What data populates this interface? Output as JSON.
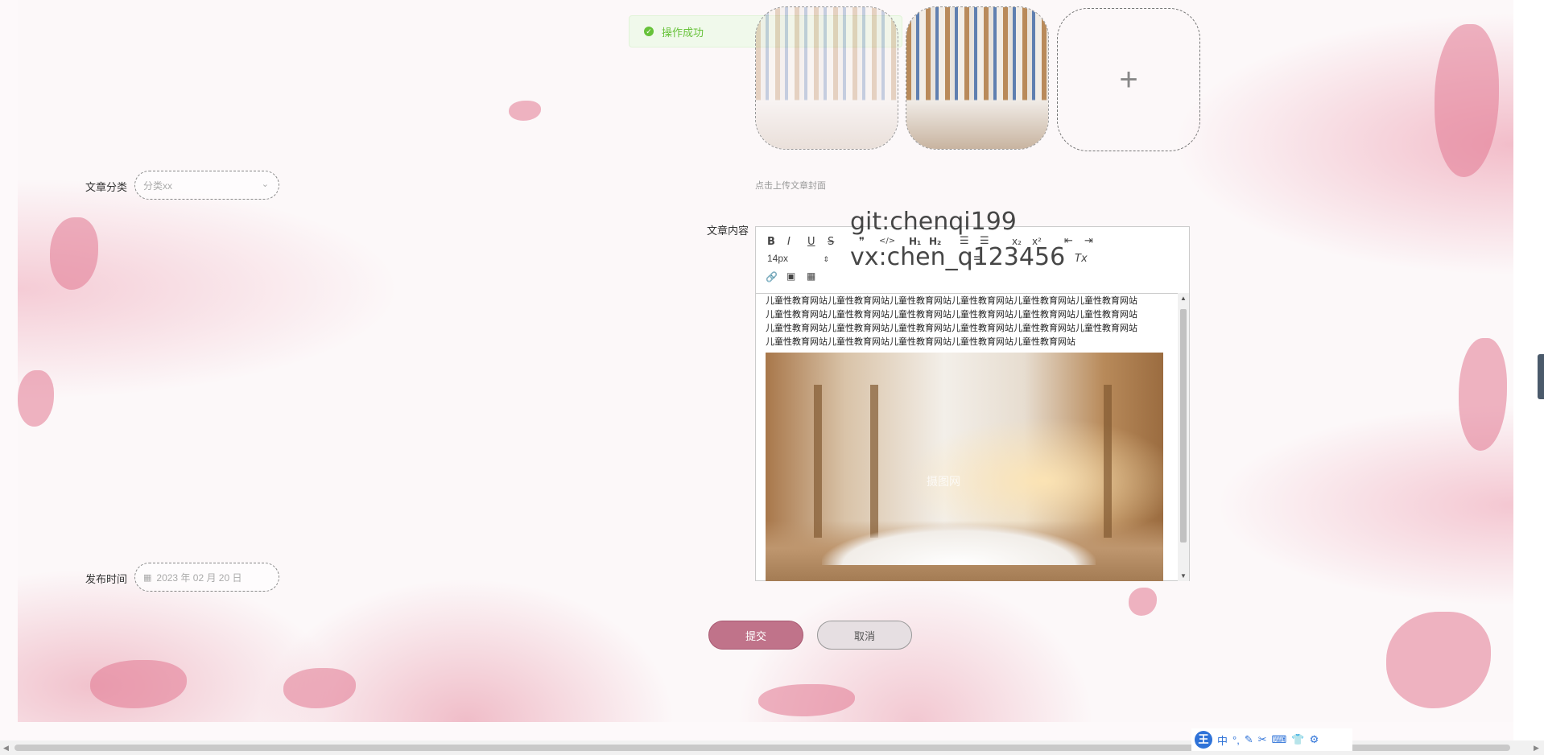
{
  "toast": {
    "icon": "check-circle-icon",
    "message": "操作成功"
  },
  "cover": {
    "tip": "点击上传文章封面",
    "add_icon": "plus-icon",
    "add_symbol": "+"
  },
  "form": {
    "category": {
      "label": "文章分类",
      "placeholder": "分类xx",
      "icon": "chevron-down-icon"
    },
    "content": {
      "label": "文章内容"
    },
    "publish_time": {
      "label": "发布时间",
      "value": "2023 年 02 月 20 日",
      "icon": "calendar-icon"
    }
  },
  "editor": {
    "toolbar": {
      "row1": [
        "B",
        "I",
        "U",
        "S",
        "❞",
        "</>",
        "H₁",
        "H₂",
        "ol",
        "ul",
        "x₂",
        "x²",
        "outdent",
        "indent"
      ],
      "font_size": "14px",
      "row3": [
        "link",
        "image",
        "video"
      ],
      "clear": "Tx"
    },
    "text_lines": [
      "儿童性教育网站儿童性教育网站儿童性教育网站儿童性教育网站儿童性教育网站儿童性教育网站",
      "儿童性教育网站儿童性教育网站儿童性教育网站儿童性教育网站儿童性教育网站儿童性教育网站",
      "儿童性教育网站儿童性教育网站儿童性教育网站儿童性教育网站儿童性教育网站儿童性教育网站",
      "儿童性教育网站儿童性教育网站儿童性教育网站儿童性教育网站儿童性教育网站"
    ],
    "image_watermark": "摄图网"
  },
  "overlay": {
    "line1": "git:chenqi199",
    "line2": "vx:chen_q123456"
  },
  "buttons": {
    "submit": "提交",
    "cancel": "取消"
  },
  "ime": {
    "logo": "王",
    "items": [
      "中",
      "°,",
      "✎",
      "✂",
      "⌨",
      "👕",
      "⚙"
    ]
  }
}
